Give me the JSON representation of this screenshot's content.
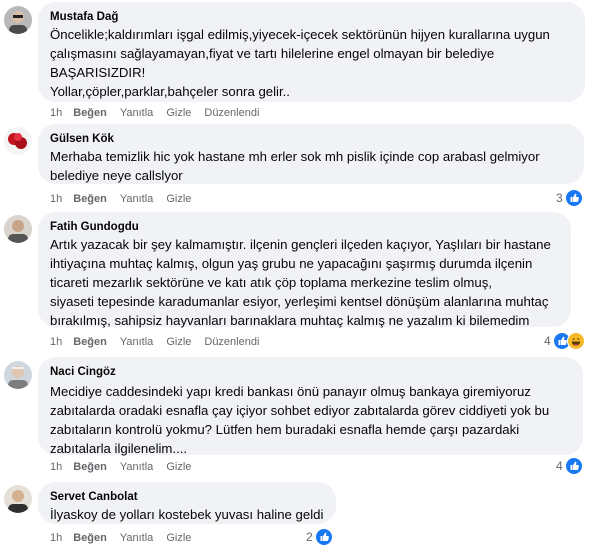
{
  "comments": [
    {
      "author": "Mustafa Dağ",
      "text": "Öncelikle;kaldırımları işgal edilmiş,yiyecek-içecek sektörünün hijyen kurallarına uygun\nçalışmasını sağlayamayan,fiyat ve tartı hilelerine engel olmayan bir belediye\nBAŞARISIZDIR!\nYollar,çöpler,parklar,bahçeler sonra gelir..",
      "time": "1h",
      "like": "Beğen",
      "reply": "Yanıtla",
      "hide": "Gizle",
      "edited": "Düzenlendi",
      "reaction_count": ""
    },
    {
      "author": "Gülsen Kök",
      "text": "Merhaba temizlik hic yok hastane mh erler sok mh pislik içinde cop arabasl gelmiyor\nbelediye neye callslyor",
      "time": "1h",
      "like": "Beğen",
      "reply": "Yanıtla",
      "hide": "Gizle",
      "edited": "",
      "reaction_count": "3"
    },
    {
      "author": "Fatih Gundogdu",
      "text": "Artık yazacak bir şey kalmamıştır. ilçenin gençleri ilçeden kaçıyor, Yaşlıları bir hastane\nihtiyaçına muhtaç kalmış, olgun yaş grubu ne yapacağını şaşırmış durumda ilçenin\nticareti mezarlık sektörüne ve katı atık çöp toplama merkezine teslim olmuş,\nsiyaseti tepesinde karadumanlar esiyor, yerleşimi kentsel dönüşüm alanlarına muhtaç\nbırakılmış, sahipsiz hayvanları barınaklara muhtaç kalmış ne yazalım ki bilemedim",
      "time": "1h",
      "like": "Beğen",
      "reply": "Yanıtla",
      "hide": "Gizle",
      "edited": "Düzenlendi",
      "reaction_count": "4"
    },
    {
      "author": "Naci Cingöz",
      "text": "Mecidiye caddesindeki yapı kredi bankası önü panayır olmuş bankaya giremiyoruz\nzabıtalarda oradaki esnafla çay içiyor sohbet ediyor zabıtalarda görev ciddiyeti yok bu\nzabıtaların kontrolü yokmu? Lütfen hem buradaki esnafla hemde çarşı pazardaki\nzabıtalarla ilgilenelim....",
      "time": "1h",
      "like": "Beğen",
      "reply": "Yanıtla",
      "hide": "Gizle",
      "edited": "",
      "reaction_count": "4"
    },
    {
      "author": "Servet Canbolat",
      "text": "İlyaskoy de yolları kostebek yuvası haline geldi",
      "time": "1h",
      "like": "Beğen",
      "reply": "Yanıtla",
      "hide": "Gizle",
      "edited": "",
      "reaction_count": "2"
    }
  ],
  "colors": {
    "bubble": "#f0f2f5",
    "secondary_text": "#65676b",
    "like_blue": "#1877f2",
    "haha_yellow": "#f7b928"
  },
  "icons": {
    "like_reaction": "thumbs-up-icon",
    "haha_reaction": "laughing-face-icon"
  }
}
